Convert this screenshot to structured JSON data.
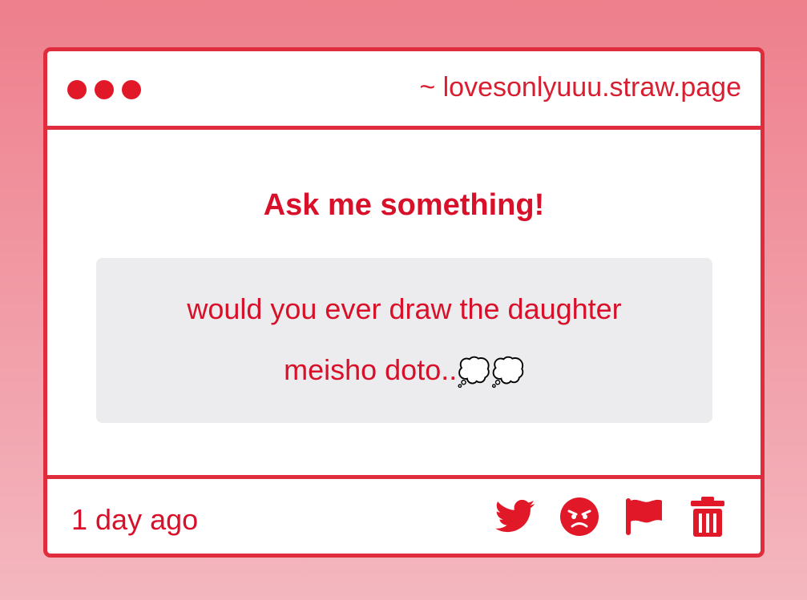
{
  "window": {
    "url": "~ lovesonlyuuu.straw.page"
  },
  "content": {
    "heading": "Ask me something!",
    "question": "would you ever draw the daughter meisho doto..",
    "emoji": "💭💭"
  },
  "footer": {
    "timestamp": "1 day ago",
    "actions": [
      "twitter-icon",
      "angry-face-icon",
      "flag-icon",
      "trash-icon"
    ]
  },
  "colors": {
    "accent": "#e02d3d",
    "text_red": "#d8102a",
    "question_bg": "#ecebed",
    "background_top": "#ee7f8c",
    "background_bottom": "#f4b7bf"
  }
}
